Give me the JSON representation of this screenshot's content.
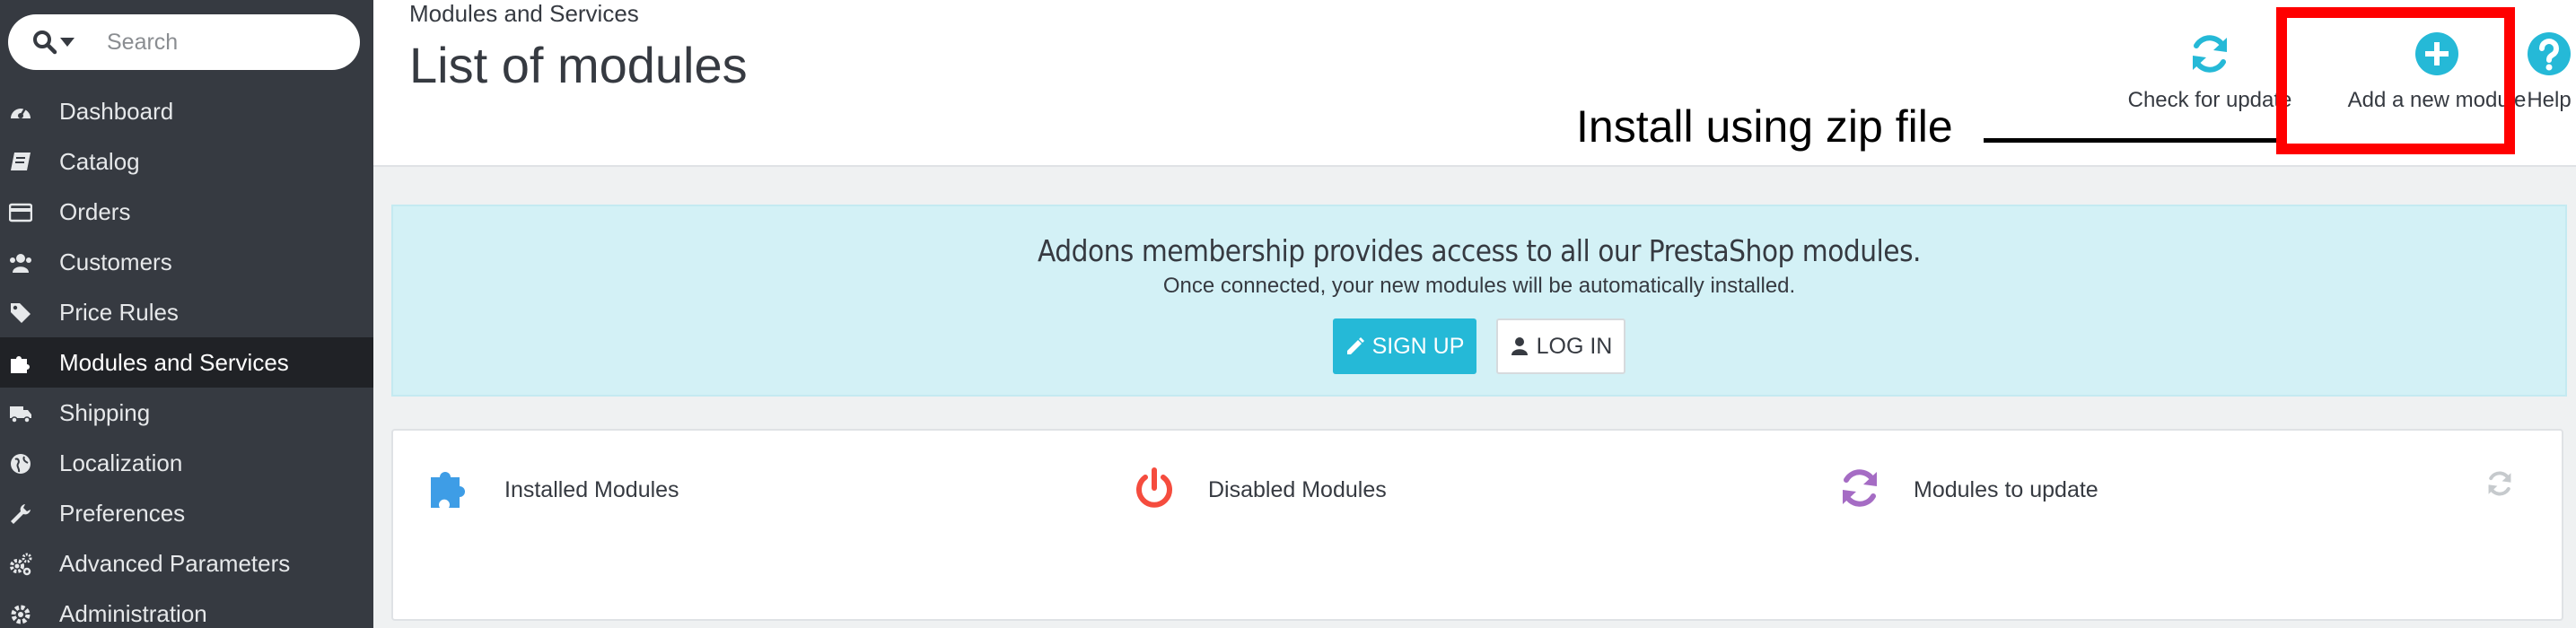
{
  "sidebar": {
    "search_placeholder": "Search",
    "items": [
      {
        "label": "Dashboard",
        "icon": "dashboard-icon"
      },
      {
        "label": "Catalog",
        "icon": "book-icon"
      },
      {
        "label": "Orders",
        "icon": "credit-card-icon"
      },
      {
        "label": "Customers",
        "icon": "users-icon"
      },
      {
        "label": "Price Rules",
        "icon": "tags-icon"
      },
      {
        "label": "Modules and Services",
        "icon": "puzzle-icon",
        "active": true
      },
      {
        "label": "Shipping",
        "icon": "truck-icon"
      },
      {
        "label": "Localization",
        "icon": "globe-icon"
      },
      {
        "label": "Preferences",
        "icon": "wrench-icon"
      },
      {
        "label": "Advanced Parameters",
        "icon": "cogs-icon"
      },
      {
        "label": "Administration",
        "icon": "gear-icon"
      }
    ]
  },
  "header": {
    "breadcrumb": "Modules and Services",
    "title": "List of modules",
    "toolbar": {
      "check_update": "Check for update",
      "add_module": "Add a new module",
      "help": "Help"
    }
  },
  "annotation": {
    "text": "Install using zip file",
    "color": "#ff0000"
  },
  "banner": {
    "heading": "Addons membership provides access to all our PrestaShop modules.",
    "subtext": "Once connected, your new modules will be automatically installed.",
    "signup": "SIGN UP",
    "login": "LOG IN"
  },
  "stats": {
    "installed": "Installed Modules",
    "disabled": "Disabled Modules",
    "to_update": "Modules to update"
  },
  "colors": {
    "accent": "#25b9d7",
    "sidebar_bg": "#363a41",
    "danger": "#f54c3e",
    "purple": "#a56cc4",
    "blue": "#3e9de6"
  }
}
